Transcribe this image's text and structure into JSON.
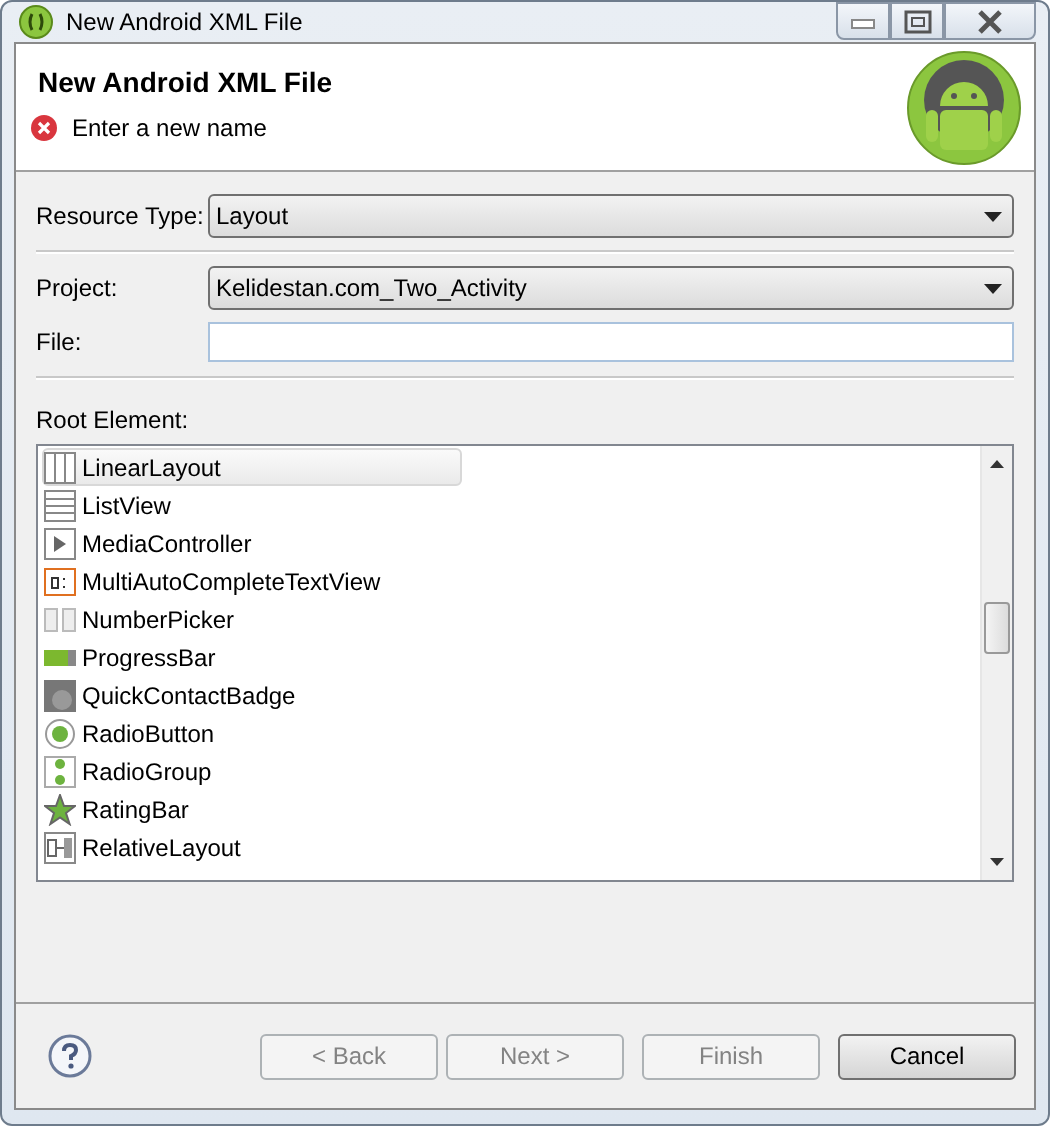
{
  "window": {
    "title": "New Android XML File"
  },
  "header": {
    "title": "New Android XML File",
    "message": "Enter a new name"
  },
  "form": {
    "resource_type": {
      "label": "Resource Type:",
      "value": "Layout"
    },
    "project": {
      "label": "Project:",
      "value": "Kelidestan.com_Two_Activity"
    },
    "file": {
      "label": "File:"
    }
  },
  "root_element": {
    "label": "Root Element:",
    "items": [
      {
        "label": "LinearLayout",
        "kind": "linear",
        "selected": true
      },
      {
        "label": "ListView",
        "kind": "list",
        "selected": false
      },
      {
        "label": "MediaController",
        "kind": "media",
        "selected": false
      },
      {
        "label": "MultiAutoCompleteTextView",
        "kind": "text",
        "selected": false
      },
      {
        "label": "NumberPicker",
        "kind": "picker",
        "selected": false
      },
      {
        "label": "ProgressBar",
        "kind": "progress",
        "selected": false
      },
      {
        "label": "QuickContactBadge",
        "kind": "badge",
        "selected": false
      },
      {
        "label": "RadioButton",
        "kind": "radio",
        "selected": false
      },
      {
        "label": "RadioGroup",
        "kind": "radiogroup",
        "selected": false
      },
      {
        "label": "RatingBar",
        "kind": "rating",
        "selected": false
      },
      {
        "label": "RelativeLayout",
        "kind": "relative",
        "selected": false
      }
    ]
  },
  "buttons": [
    {
      "label": "< Back",
      "disabled": true
    },
    {
      "label": "Next >",
      "disabled": true
    },
    {
      "label": "Finish",
      "disabled": true
    },
    {
      "label": "Cancel",
      "disabled": false
    }
  ]
}
